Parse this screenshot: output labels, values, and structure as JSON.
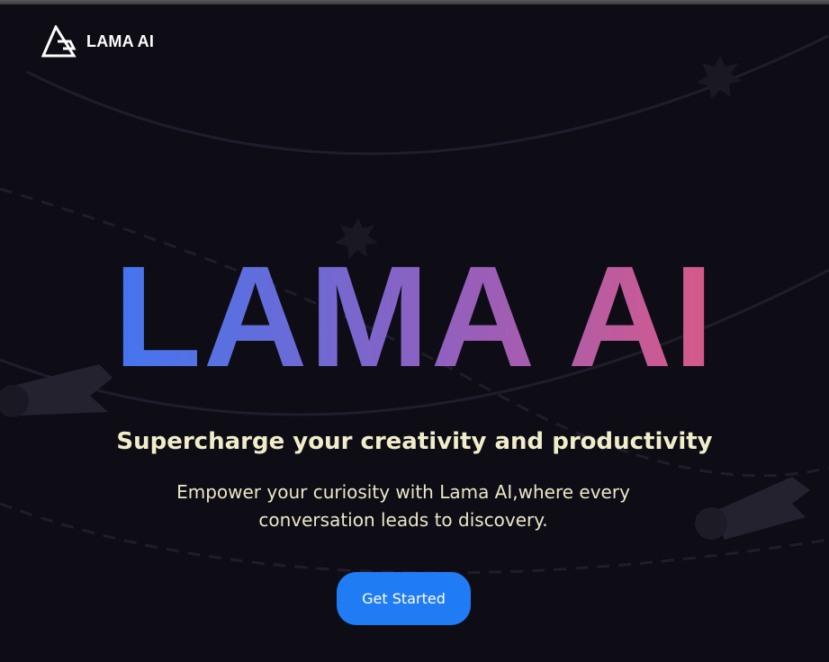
{
  "brand": {
    "name": "LAMA AI",
    "icon": "lama-logo-icon"
  },
  "hero": {
    "title": "LAMA AI",
    "tagline": "Supercharge your creativity and productivity",
    "description": "Empower your curiosity with Lama AI,where every conversation leads to discovery.",
    "cta_label": "Get Started"
  },
  "colors": {
    "background": "#0e0d16",
    "gradient_start": "#2f7bff",
    "gradient_end": "#e8526a",
    "tagline": "#f1ecc9",
    "cta": "#1f7cf5"
  },
  "decorations": [
    "star-icon",
    "star-icon",
    "comet-icon",
    "comet-icon",
    "orbit-lines"
  ]
}
